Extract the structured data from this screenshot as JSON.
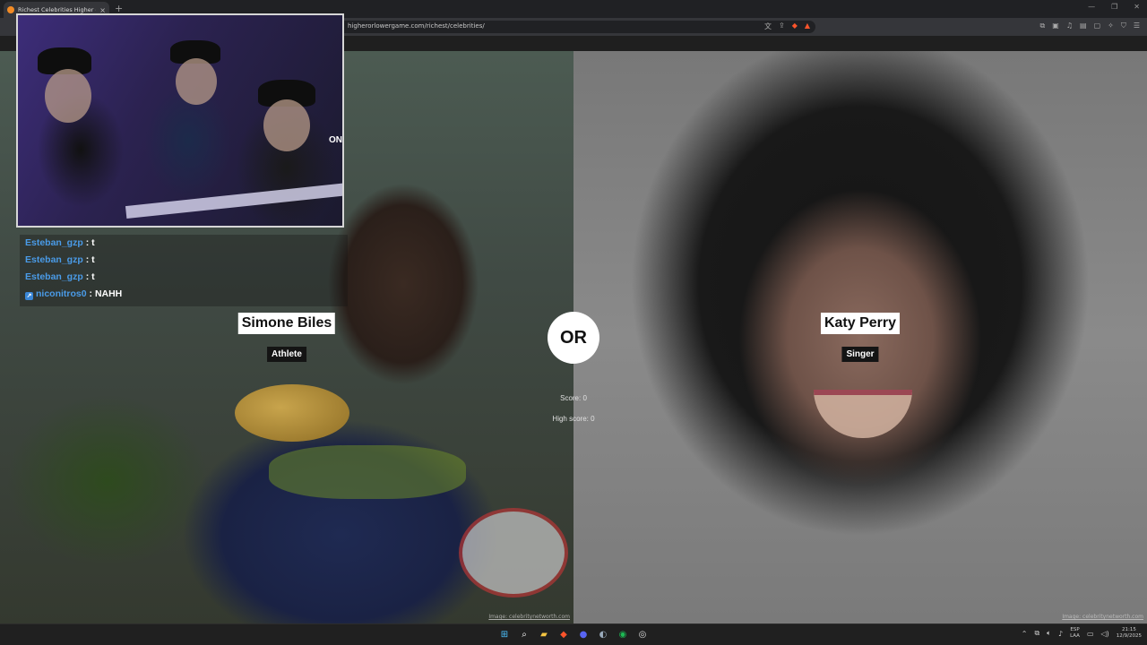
{
  "browser": {
    "tab_title": "Richest Celebrities Higher or Lower",
    "tab_close": "×",
    "new_tab": "+",
    "url": "higherorlowergame.com/richest/celebrities/"
  },
  "game": {
    "left": {
      "name": "Simone Biles",
      "category": "Athlete",
      "credit": "Image: celebritynetworth.com"
    },
    "right": {
      "name": "Katy Perry",
      "category": "Singer",
      "credit": "Image: celebritynetworth.com"
    },
    "or_label": "OR",
    "score_label": "Score: 0",
    "high_score_label": "High score: 0"
  },
  "stream": {
    "cam_side_text": "ON",
    "chat": [
      {
        "user": "Esteban_gzp",
        "message": "t"
      },
      {
        "user": "Esteban_gzp",
        "message": "t"
      },
      {
        "user": "Esteban_gzp",
        "message": "t"
      },
      {
        "user": "niconitros0",
        "message": "NAHH"
      }
    ],
    "chat_separator": ":"
  },
  "taskbar": {
    "lang_top": "ESP",
    "lang_bottom": "LAA",
    "time": "21:15",
    "date": "12/9/2025",
    "icons": [
      "windows-start-icon",
      "search-icon",
      "file-explorer-icon",
      "brave-icon",
      "discord-icon",
      "steam-icon",
      "spotify-icon",
      "obs-icon"
    ]
  },
  "colors": {
    "chat_username": "#4a9be8",
    "brave_accent": "#fb542b",
    "spotify": "#1db954",
    "discord": "#5865f2"
  }
}
